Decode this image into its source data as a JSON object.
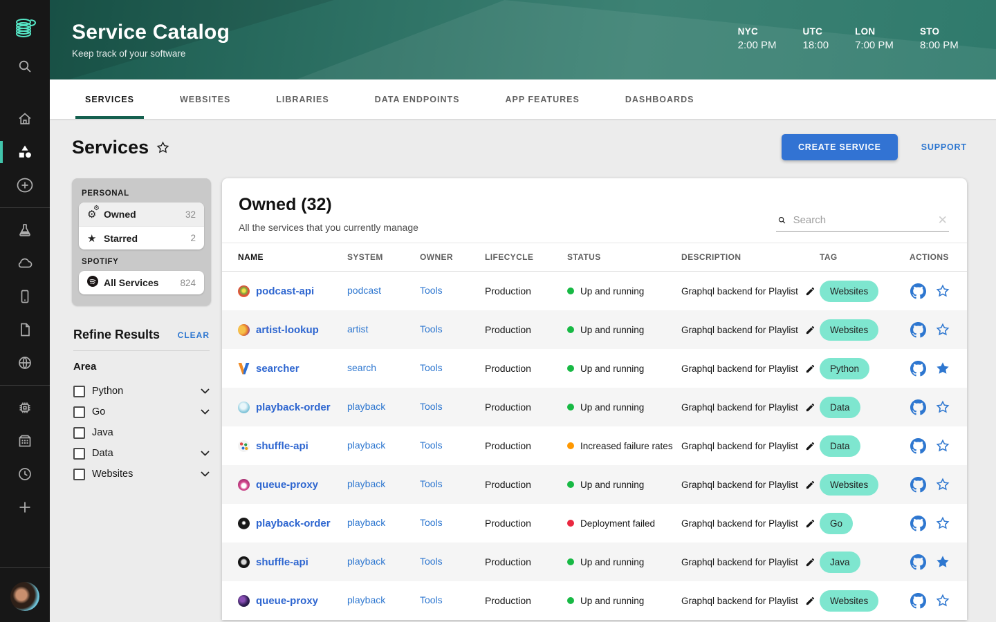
{
  "theme": {
    "sidebar_bg": "#171717",
    "accent_teal": "#41c4ab",
    "header_green": "#2e7265",
    "tab_indicator": "#15604f",
    "link_blue": "#2e77d0",
    "button_blue": "#3273d3",
    "tag_bg": "#7ee6cf",
    "status_ok": "#17b944",
    "status_warn": "#ff9800",
    "status_error": "#ea2840"
  },
  "sidebar": {
    "icons_top": [
      "backstage-logo",
      "search",
      "home",
      "catalog",
      "create"
    ],
    "icons_mid": [
      "explore",
      "cloud",
      "mobile",
      "docs",
      "web"
    ],
    "icons_low": [
      "tech",
      "org",
      "time",
      "add"
    ]
  },
  "header": {
    "title": "Service Catalog",
    "subtitle": "Keep track of your software",
    "clocks": [
      {
        "label": "NYC",
        "time": "2:00 PM"
      },
      {
        "label": "UTC",
        "time": "18:00"
      },
      {
        "label": "LON",
        "time": "7:00 PM"
      },
      {
        "label": "STO",
        "time": "8:00 PM"
      }
    ]
  },
  "tabs": [
    {
      "label": "SERVICES",
      "active": true
    },
    {
      "label": "WEBSITES",
      "active": false
    },
    {
      "label": "LIBRARIES",
      "active": false
    },
    {
      "label": "DATA ENDPOINTS",
      "active": false
    },
    {
      "label": "APP FEATURES",
      "active": false
    },
    {
      "label": "DASHBOARDS",
      "active": false
    }
  ],
  "page": {
    "title": "Services",
    "create_button": "CREATE SERVICE",
    "support_link": "SUPPORT"
  },
  "filters": {
    "personal_label": "PERSONAL",
    "personal_items": [
      {
        "icon": "gears",
        "label": "Owned",
        "count": "32",
        "selected": true
      },
      {
        "icon": "star",
        "label": "Starred",
        "count": "2",
        "selected": false
      }
    ],
    "org_label": "SPOTIFY",
    "org_items": [
      {
        "icon": "spotify",
        "label": "All Services",
        "count": "824",
        "selected": false
      }
    ],
    "refine_title": "Refine Results",
    "clear_label": "CLEAR",
    "area_label": "Area",
    "area_options": [
      {
        "label": "Python",
        "expandable": true,
        "checked": false
      },
      {
        "label": "Go",
        "expandable": true,
        "checked": false
      },
      {
        "label": "Java",
        "expandable": false,
        "checked": false
      },
      {
        "label": "Data",
        "expandable": true,
        "checked": false
      },
      {
        "label": "Websites",
        "expandable": true,
        "checked": false
      }
    ]
  },
  "table": {
    "title": "Owned (32)",
    "subtitle": "All the services that you currently manage",
    "search_placeholder": "Search",
    "columns": [
      "NAME",
      "SYSTEM",
      "OWNER",
      "LIFECYCLE",
      "STATUS",
      "DESCRIPTION",
      "TAG",
      "ACTIONS"
    ],
    "rows": [
      {
        "name": "podcast-api",
        "icon": "podcast",
        "system": "podcast",
        "owner": "Tools",
        "lifecycle": "Production",
        "status": "Up and running",
        "status_level": "ok",
        "description": "Graphql backend for Playlist",
        "tag": "Websites",
        "starred": false
      },
      {
        "name": "artist-lookup",
        "icon": "artist",
        "system": "artist",
        "owner": "Tools",
        "lifecycle": "Production",
        "status": "Up and running",
        "status_level": "ok",
        "description": "Graphql backend for Playlist",
        "tag": "Websites",
        "starred": false
      },
      {
        "name": "searcher",
        "icon": "searcher",
        "system": "search",
        "owner": "Tools",
        "lifecycle": "Production",
        "status": "Up and running",
        "status_level": "ok",
        "description": "Graphql backend for Playlist",
        "tag": "Python",
        "starred": true
      },
      {
        "name": "playback-order",
        "icon": "playback1",
        "system": "playback",
        "owner": "Tools",
        "lifecycle": "Production",
        "status": "Up and running",
        "status_level": "ok",
        "description": "Graphql backend for Playlist",
        "tag": "Data",
        "starred": false
      },
      {
        "name": "shuffle-api",
        "icon": "shuffle1",
        "system": "playback",
        "owner": "Tools",
        "lifecycle": "Production",
        "status": "Increased failure rates",
        "status_level": "warn",
        "description": "Graphql backend for Playlist",
        "tag": "Data",
        "starred": false
      },
      {
        "name": "queue-proxy",
        "icon": "queue1",
        "system": "playback",
        "owner": "Tools",
        "lifecycle": "Production",
        "status": "Up and running",
        "status_level": "ok",
        "description": "Graphql backend for Playlist",
        "tag": "Websites",
        "starred": false
      },
      {
        "name": "playback-order",
        "icon": "playback2",
        "system": "playback",
        "owner": "Tools",
        "lifecycle": "Production",
        "status": "Deployment failed",
        "status_level": "error",
        "description": "Graphql backend for Playlist",
        "tag": "Go",
        "starred": false
      },
      {
        "name": "shuffle-api",
        "icon": "shuffle2",
        "system": "playback",
        "owner": "Tools",
        "lifecycle": "Production",
        "status": "Up and running",
        "status_level": "ok",
        "description": "Graphql backend for Playlist",
        "tag": "Java",
        "starred": true
      },
      {
        "name": "queue-proxy",
        "icon": "queue2",
        "system": "playback",
        "owner": "Tools",
        "lifecycle": "Production",
        "status": "Up and running",
        "status_level": "ok",
        "description": "Graphql backend for Playlist",
        "tag": "Websites",
        "starred": false
      }
    ]
  }
}
